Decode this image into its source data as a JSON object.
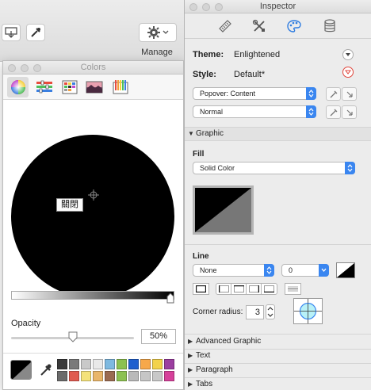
{
  "background_app": {
    "manage_label": "Manage",
    "icons": [
      "export-icon",
      "eyedropper-icon",
      "gear-icon"
    ]
  },
  "colors_panel": {
    "title": "Colors",
    "modes": [
      "color-wheel",
      "color-sliders",
      "color-palettes",
      "image-palettes",
      "pencils"
    ],
    "active_mode": "color-wheel",
    "tooltip": "關閉",
    "opacity_label": "Opacity",
    "opacity_value": "50%",
    "opacity_fraction": 0.5,
    "brightness_fraction": 1.0,
    "swatches": [
      "#3a3a3a",
      "#7a7a7a",
      "#c9c9c9",
      "#e9e9e9",
      "#7eb9e0",
      "#8cc151",
      "#1f5fcf",
      "#f7a84a",
      "#f3d24a",
      "#9b3ea0",
      "#6b6b6b",
      "#e05a4f",
      "#f4e27a",
      "#e9b66a",
      "#9a6b52",
      "#8cc151",
      "#b9b9b9",
      "#c6c6c6",
      "#c8c8c8",
      "#d6409a"
    ]
  },
  "inspector": {
    "title": "Inspector",
    "tabs": [
      "ruler-icon",
      "tools-icon",
      "palette-icon",
      "database-icon"
    ],
    "active_tab": "palette-icon",
    "theme_label": "Theme:",
    "theme_value": "Enlightened",
    "style_label": "Style:",
    "style_value": "Default*",
    "popover_select": "Popover: Content",
    "state_select": "Normal",
    "graphic_section": "Graphic",
    "fill_label": "Fill",
    "fill_select": "Solid Color",
    "line_label": "Line",
    "line_style_select": "None",
    "line_width_select": "0",
    "corner_radius_label": "Corner radius:",
    "corner_radius_value": "3",
    "collapsed_sections": [
      "Advanced Graphic",
      "Text",
      "Paragraph",
      "Tabs"
    ],
    "colors": {
      "accent": "#3a86f0",
      "alert": "#e0463c"
    }
  }
}
